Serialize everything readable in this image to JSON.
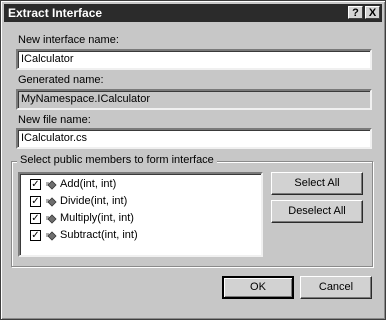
{
  "window": {
    "title": "Extract Interface",
    "help_glyph": "?",
    "close_glyph": "X"
  },
  "interface_name": {
    "label": "New interface name:",
    "value": "ICalculator"
  },
  "generated_name": {
    "label": "Generated name:",
    "value": "MyNamespace.ICalculator"
  },
  "file_name": {
    "label": "New file name:",
    "value": "ICalculator.cs"
  },
  "members_group": {
    "title": "Select public members to form interface",
    "items": [
      {
        "label": "Add(int, int)",
        "checked": true,
        "icon": "method-icon"
      },
      {
        "label": "Divide(int, int)",
        "checked": true,
        "icon": "method-icon"
      },
      {
        "label": "Multiply(int, int)",
        "checked": true,
        "icon": "method-icon"
      },
      {
        "label": "Subtract(int, int)",
        "checked": true,
        "icon": "method-icon"
      }
    ],
    "select_all_label": "Select All",
    "deselect_all_label": "Deselect All"
  },
  "footer": {
    "ok_label": "OK",
    "cancel_label": "Cancel"
  }
}
